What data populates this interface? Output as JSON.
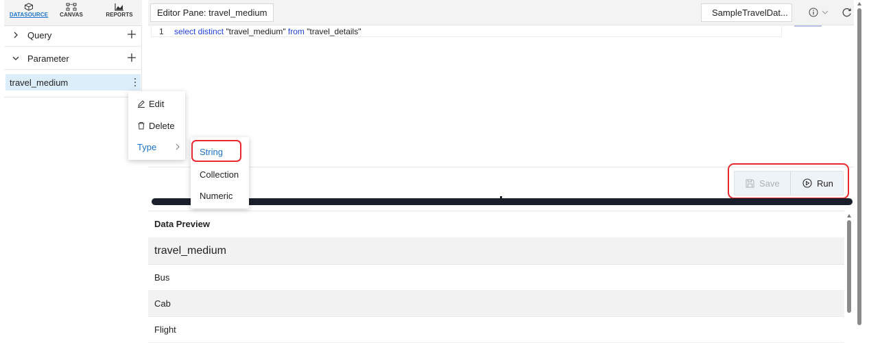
{
  "nav": {
    "datasource": "DATASOURCE",
    "canvas": "CANVAS",
    "reports": "REPORTS"
  },
  "sidebar": {
    "query_label": "Query",
    "parameter_label": "Parameter",
    "parameter_item": "travel_medium"
  },
  "context_menu": {
    "edit": "Edit",
    "delete": "Delete",
    "type": "Type",
    "type_options": [
      "String",
      "Collection",
      "Numeric"
    ]
  },
  "editor": {
    "title": "Editor Pane: travel_medium",
    "datasource": "SampleTravelDat...",
    "line_number": "1",
    "code": {
      "kw1": "select distinct",
      "col": " \"travel_medium\" ",
      "kw2": "from",
      "table": " \"travel_details\""
    }
  },
  "actions": {
    "save": "Save",
    "run": "Run"
  },
  "preview": {
    "title": "Data Preview",
    "column": "travel_medium",
    "rows": [
      "Bus",
      "Cab",
      "Flight"
    ]
  },
  "colors": {
    "accent": "#1a73c8",
    "highlight": "#e8262d",
    "selection": "#dceefa",
    "splitter": "#1a1f2b"
  }
}
